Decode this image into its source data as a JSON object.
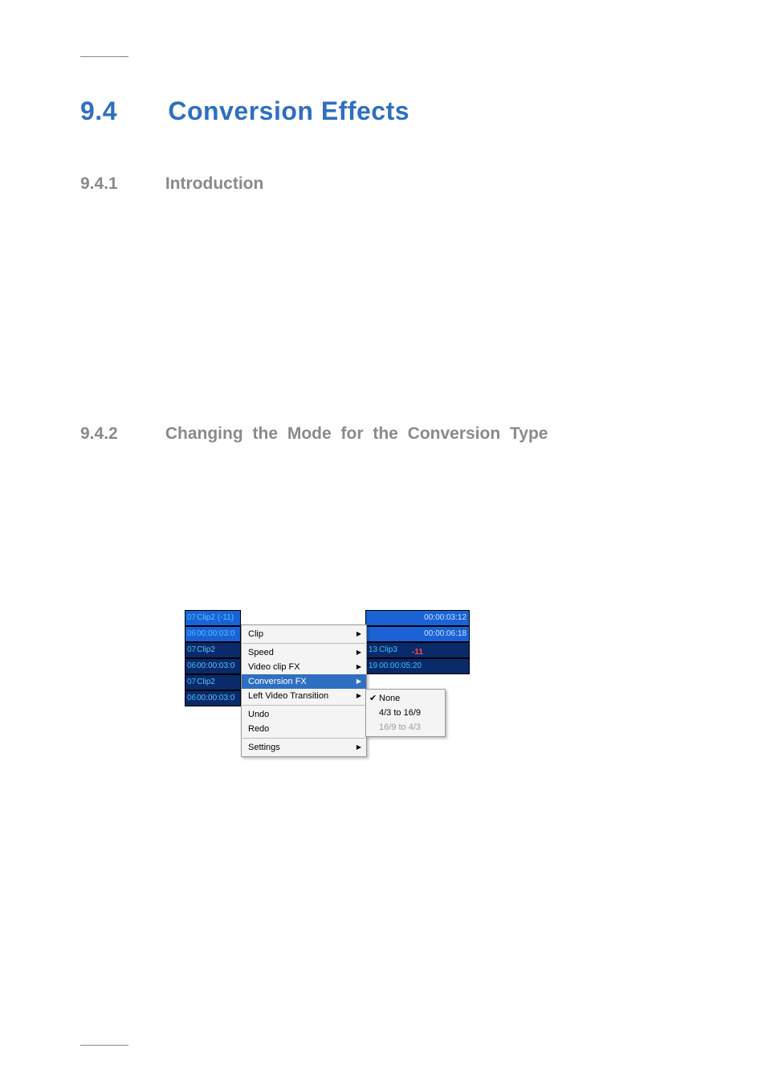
{
  "section": {
    "number": "9.4",
    "title": "Conversion  Effects"
  },
  "sub1": {
    "number": "9.4.1",
    "title": "Introduction"
  },
  "sub2": {
    "number": "9.4.2",
    "title": "Changing  the  Mode  for  the  Conversion Type"
  },
  "tracks_left": [
    {
      "num": "07",
      "text": "Clip2 (-11)",
      "selected": true
    },
    {
      "num": "06",
      "text": "00:00:03:0",
      "selected": true
    },
    {
      "num": "07",
      "text": "Clip2",
      "selected": false
    },
    {
      "num": "06",
      "text": "00:00:03:0",
      "selected": false
    },
    {
      "num": "07",
      "text": "Clip2",
      "selected": false
    },
    {
      "num": "06",
      "text": "00:00:03:0",
      "selected": false
    }
  ],
  "tracks_right": [
    {
      "text": "00:00:03:12",
      "selected": true,
      "align": "right"
    },
    {
      "text": "00:00:06:18",
      "selected": true,
      "align": "right"
    },
    {
      "num": "13",
      "text": "Clip3",
      "neg": "-11",
      "selected": false,
      "align": "left"
    },
    {
      "num": "19",
      "text": "00:00:05:20",
      "selected": false,
      "align": "left"
    }
  ],
  "context_menu": [
    [
      {
        "label": "Clip",
        "submenu": true
      }
    ],
    [
      {
        "label": "Speed",
        "submenu": true
      },
      {
        "label": "Video clip FX",
        "submenu": true
      },
      {
        "label": "Conversion FX",
        "submenu": true,
        "highlight": true
      },
      {
        "label": "Left Video Transition",
        "submenu": true
      }
    ],
    [
      {
        "label": "Undo"
      },
      {
        "label": "Redo"
      }
    ],
    [
      {
        "label": "Settings",
        "submenu": true
      }
    ]
  ],
  "conversion_submenu": [
    {
      "label": "None",
      "checked": true,
      "disabled": false
    },
    {
      "label": "4/3 to 16/9",
      "checked": false,
      "disabled": false
    },
    {
      "label": "16/9 to 4/3",
      "checked": false,
      "disabled": true
    }
  ]
}
